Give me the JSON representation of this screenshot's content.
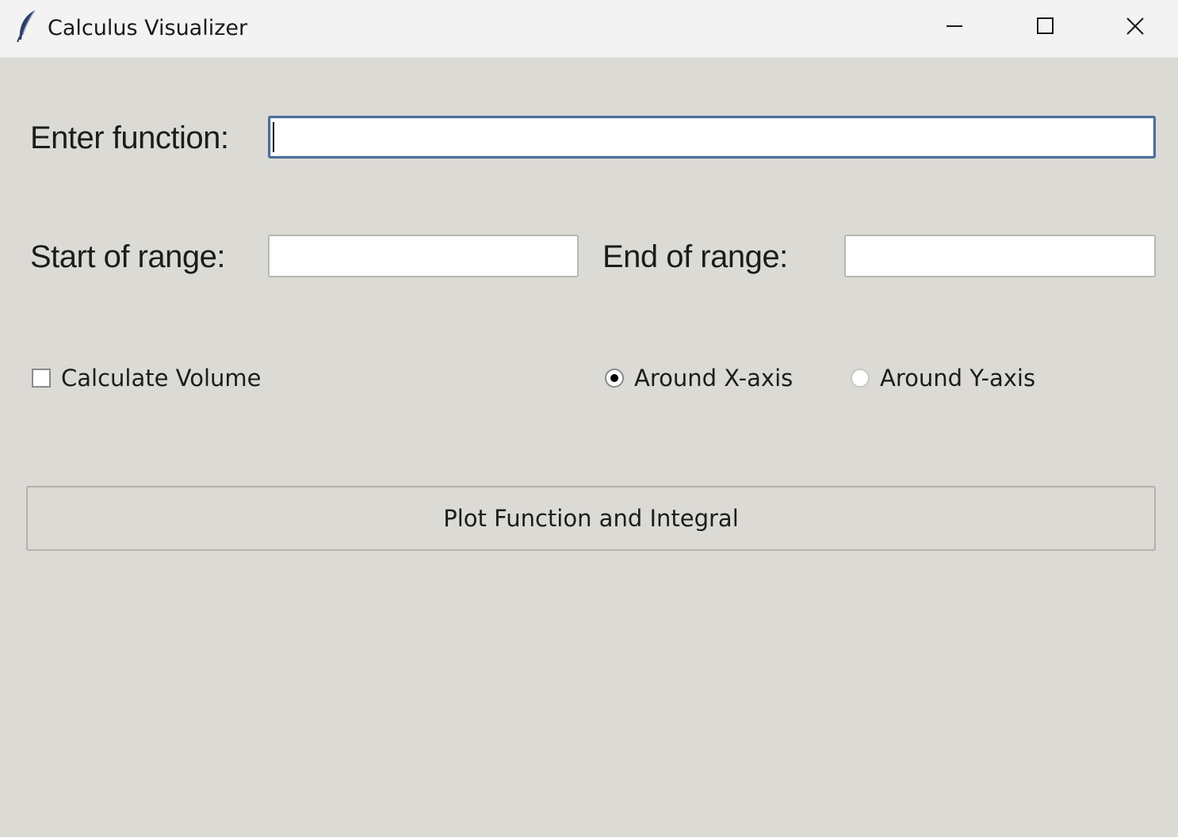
{
  "window": {
    "title": "Calculus Visualizer",
    "app_icon": "feather-icon",
    "controls": [
      "minimize-icon",
      "maximize-icon",
      "close-icon"
    ]
  },
  "form": {
    "function_label": "Enter function:",
    "function_value": "",
    "start_label": "Start of range:",
    "start_value": "",
    "end_label": "End of range:",
    "end_value": ""
  },
  "options": {
    "volume_label": "Calculate Volume",
    "volume_checked": false,
    "x_axis_label": "Around X-axis",
    "y_axis_label": "Around Y-axis",
    "selected_axis": "x"
  },
  "actions": {
    "plot_label": "Plot Function and Integral"
  }
}
